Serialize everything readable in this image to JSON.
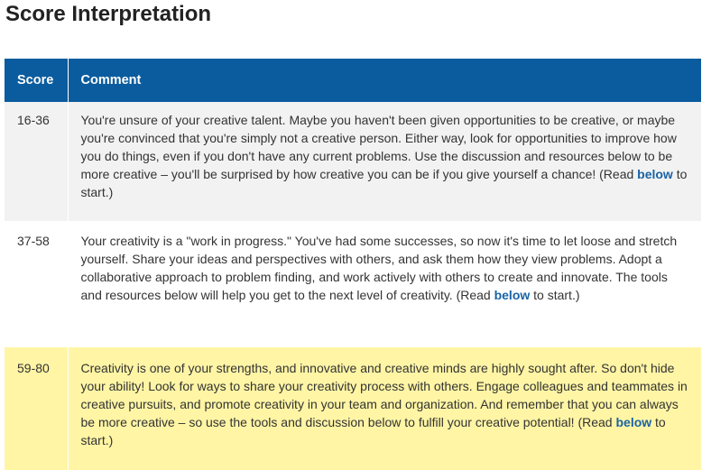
{
  "page": {
    "title": "Score Interpretation"
  },
  "table": {
    "headers": {
      "score": "Score",
      "comment": "Comment"
    },
    "rows": [
      {
        "score": "16-36",
        "comment_before": "You're unsure of your creative talent. Maybe you haven't been given opportunities to be creative, or maybe you're convinced that you're simply not a creative person. Either way, look for opportunities to improve how you do things, even if you don't have any current problems. Use the discussion and resources below to be more creative – you'll be surprised by how creative you can be if you give yourself a chance! (Read ",
        "link": "below",
        "comment_after": " to start.)",
        "background": "#f2f2f2"
      },
      {
        "score": "37-58",
        "comment_before": "Your creativity is a \"work in progress.\" You've had some successes, so now it's time to let loose and stretch yourself. Share your ideas and perspectives with others, and ask them how they view problems. Adopt a collaborative approach to problem finding, and work actively with others to create and innovate. The tools and resources below will help you get to the next level of creativity. (Read ",
        "link": "below",
        "comment_after": " to start.)",
        "background": "#ffffff"
      },
      {
        "score": "59-80",
        "comment_before": "Creativity is one of your strengths, and innovative and creative minds are highly sought after. So don't hide your ability! Look for ways to share your creativity process with others. Engage colleagues and teammates in creative pursuits, and promote creativity in your team and organization. And remember that you can always be more creative – so use the tools and discussion below to fulfill your creative potential! (Read ",
        "link": "below",
        "comment_after": " to start.)",
        "background": "#fff5a5"
      }
    ]
  },
  "colors": {
    "header_bg": "#0b5c9e",
    "link": "#1a63a5",
    "highlight_row": "#fff5a5"
  }
}
